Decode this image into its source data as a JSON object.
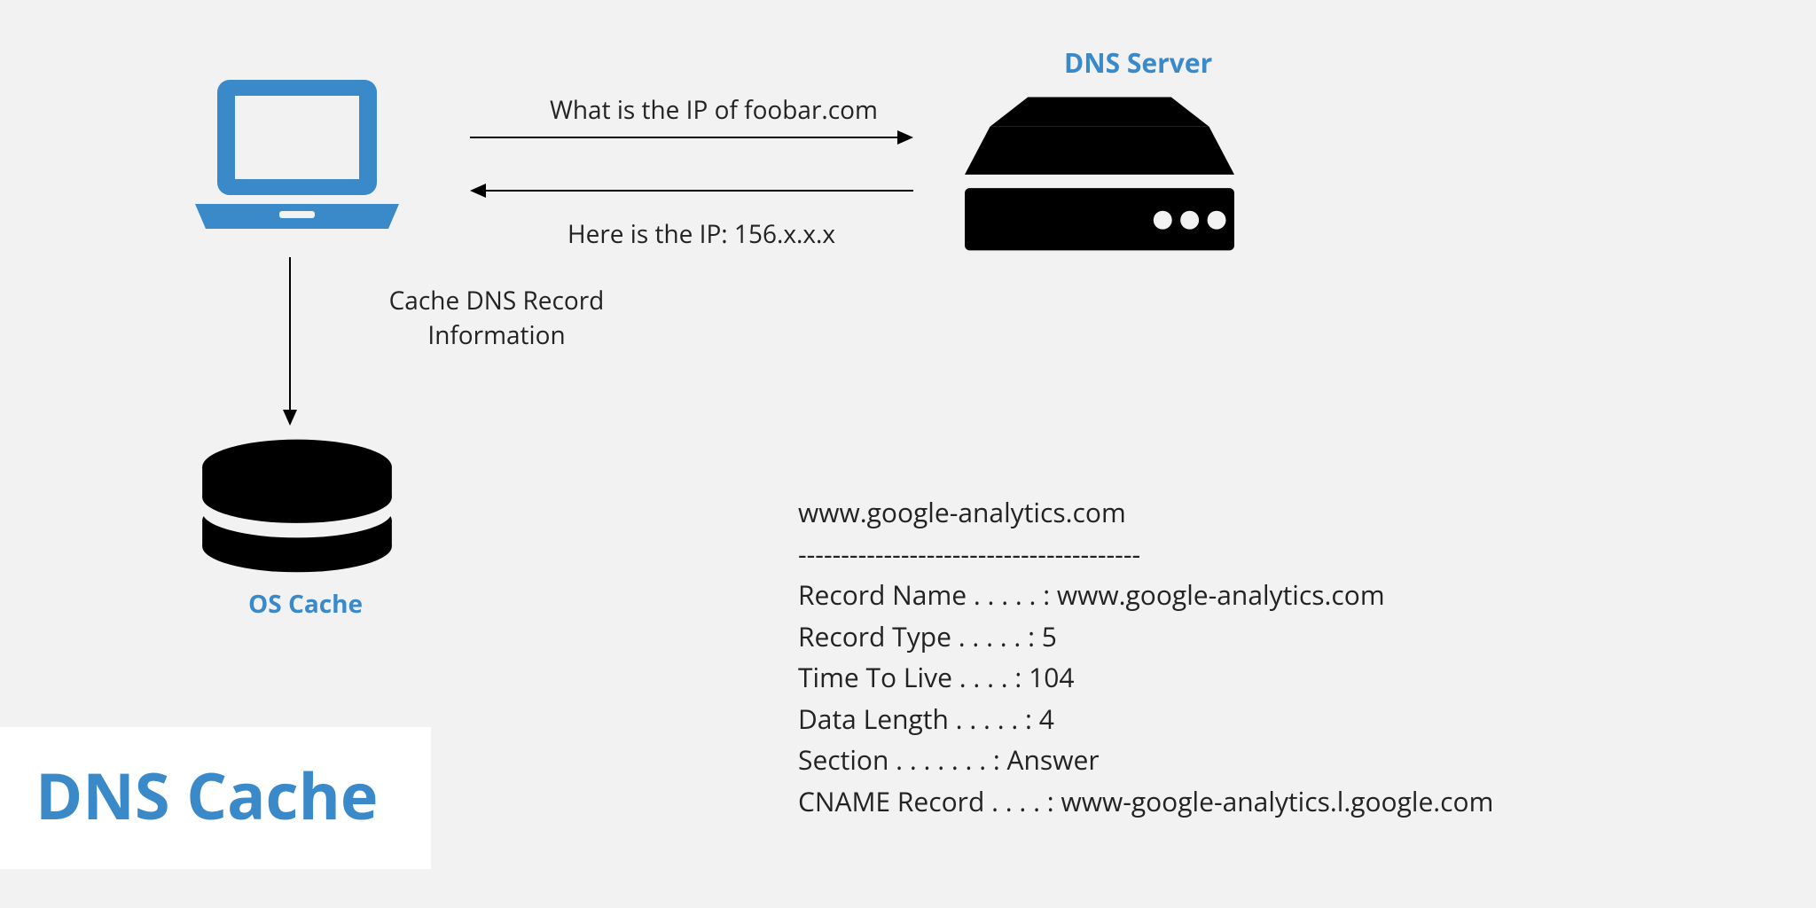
{
  "title": "DNS Cache",
  "nodes": {
    "server_label": "DNS Server",
    "cache_label": "OS Cache"
  },
  "arrows": {
    "query": "What is the IP of foobar.com",
    "response": "Here is the IP: 156.x.x.x",
    "down_line1": "Cache DNS Record",
    "down_line2": "Information"
  },
  "record": {
    "host": "www.google-analytics.com",
    "divider": "----------------------------------------",
    "record_name": "Record Name . . . . . : www.google-analytics.com",
    "record_type": "Record Type . . . . . : 5",
    "ttl": "Time To Live  . . . . : 104",
    "data_length": "Data Length . . . . . : 4",
    "section": "Section . . . . . . . : Answer",
    "cname": "CNAME Record  . . . . : www-google-analytics.l.google.com"
  },
  "colors": {
    "accent": "#3a89c9",
    "text": "#222222",
    "bg": "#f2f2f2"
  }
}
